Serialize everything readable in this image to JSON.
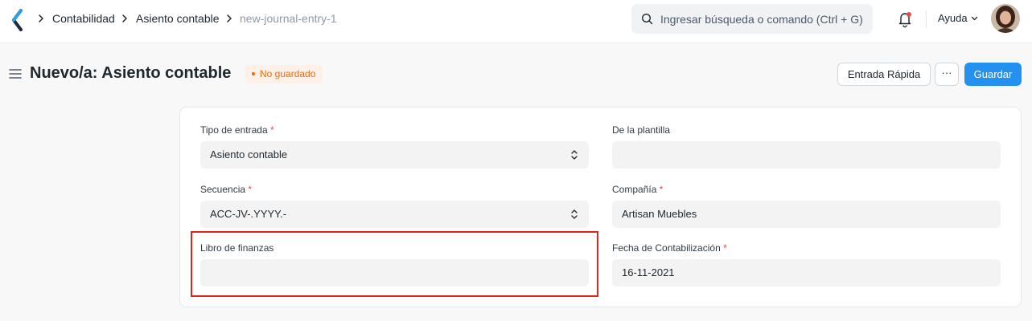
{
  "breadcrumbs": [
    "Contabilidad",
    "Asiento contable",
    "new-journal-entry-1"
  ],
  "search": {
    "placeholder": "Ingresar búsqueda o comando (Ctrl + G)"
  },
  "navbar": {
    "help_label": "Ayuda"
  },
  "page": {
    "title": "Nuevo/a: Asiento contable",
    "status": "No guardado"
  },
  "actions": {
    "quick_entry": "Entrada Rápida",
    "more": "···",
    "save": "Guardar"
  },
  "form": {
    "entry_type": {
      "label": "Tipo de entrada",
      "value": "Asiento contable"
    },
    "from_template": {
      "label": "De la plantilla",
      "value": ""
    },
    "naming_series": {
      "label": "Secuencia",
      "value": "ACC-JV-.YYYY.-"
    },
    "company": {
      "label": "Compañía",
      "value": "Artisan Muebles"
    },
    "finance_book": {
      "label": "Libro de finanzas",
      "value": ""
    },
    "posting_date": {
      "label": "Fecha de Contabilización",
      "value": "16-11-2021"
    },
    "required_mark": "*"
  },
  "colors": {
    "primary": "#2490ef",
    "status_orange": "#e86c13",
    "required_red": "#e24c4c",
    "highlight_red": "#e2231a"
  }
}
